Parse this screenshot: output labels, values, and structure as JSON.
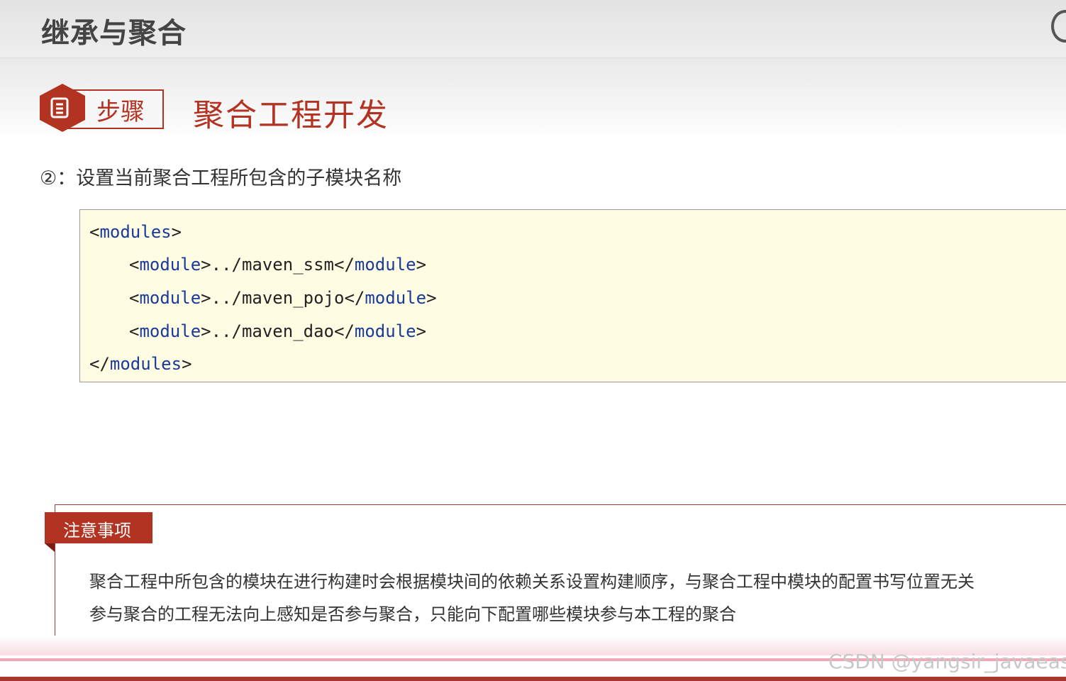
{
  "header": {
    "title": "继承与聚合"
  },
  "step": {
    "icon": "document-list-icon",
    "label": "步骤",
    "title": "聚合工程开发"
  },
  "instruction": "②：设置当前聚合工程所包含的子模块名称",
  "code": {
    "modules_open_lt": "<",
    "modules_tag": "modules",
    "modules_open_gt": ">",
    "module_open": "<",
    "module_tag": "module",
    "module_mid": ">",
    "module_close_lt": "</",
    "module_close_gt": ">",
    "items": [
      "../maven_ssm",
      "../maven_pojo",
      "../maven_dao"
    ],
    "modules_close_lt": "</",
    "modules_close_gt": ">"
  },
  "note": {
    "tag": "注意事项",
    "lines": [
      "聚合工程中所包含的模块在进行构建时会根据模块间的依赖关系设置构建顺序，与聚合工程中模块的配置书写位置无关",
      "参与聚合的工程无法向上感知是否参与聚合，只能向下配置哪些模块参与本工程的聚合"
    ]
  },
  "watermark": "CSDN @yangsir_javaeasy",
  "colors": {
    "accent": "#b23322",
    "code_bg": "#fefde3",
    "tag_text": "#1a3a9a"
  }
}
